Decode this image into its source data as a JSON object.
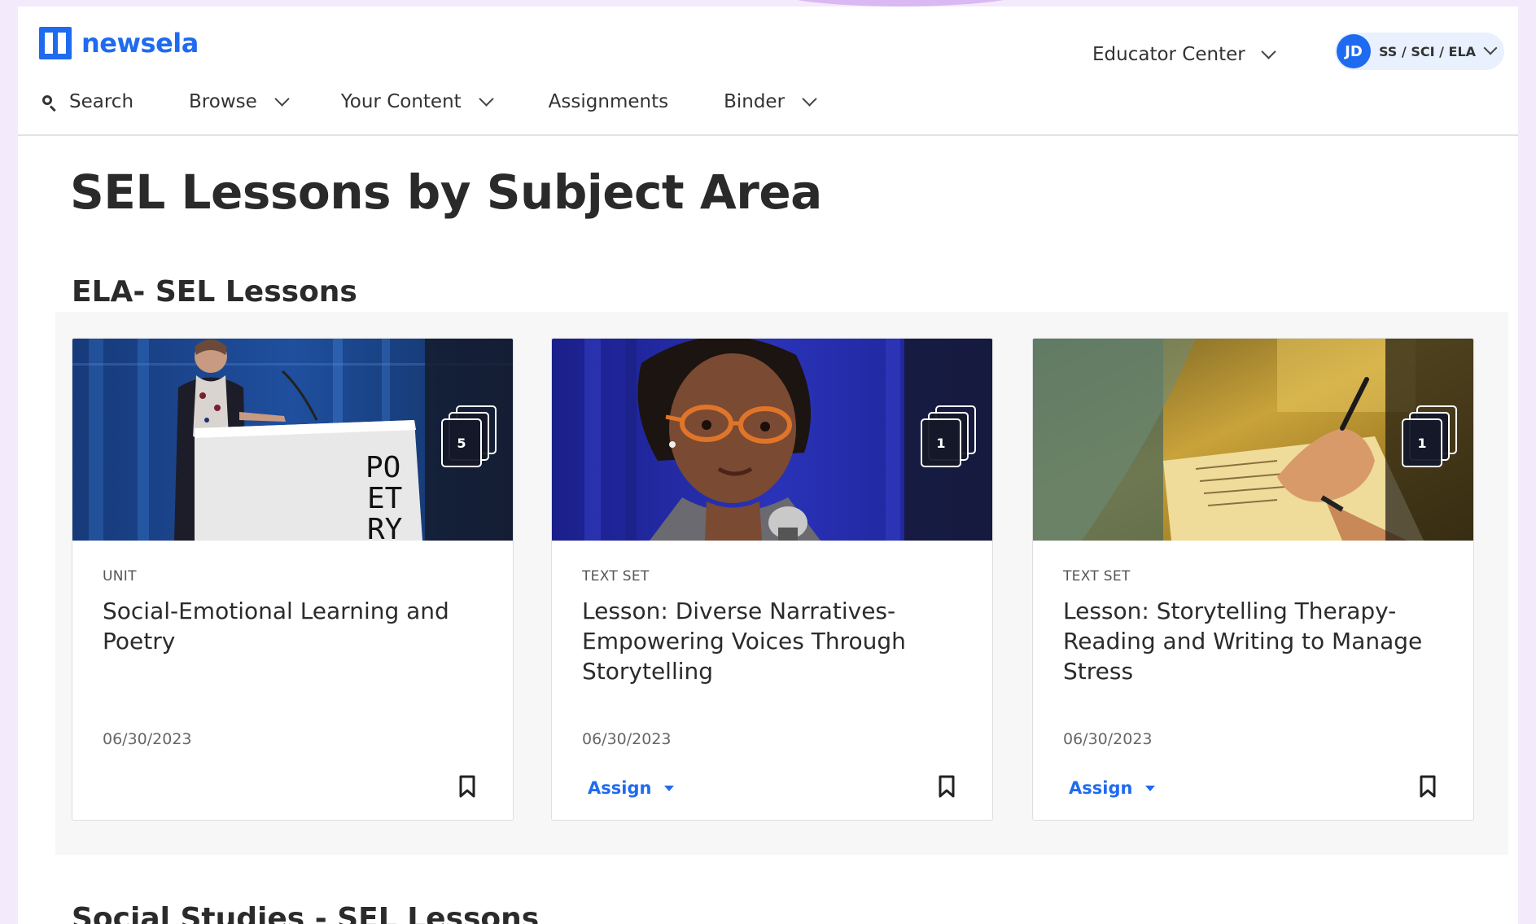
{
  "header": {
    "logo_text": "newsela",
    "educator_center": "Educator Center",
    "user": {
      "initials": "JD",
      "label": "SS / SCI / ELA"
    },
    "nav": {
      "search": "Search",
      "browse": "Browse",
      "your_content": "Your Content",
      "assignments": "Assignments",
      "binder": "Binder"
    }
  },
  "page": {
    "title": "SEL Lessons by Subject Area"
  },
  "sections": [
    {
      "title": "ELA- SEL Lessons",
      "cards": [
        {
          "type": "UNIT",
          "title": "Social-Emotional Learning and Poetry",
          "date": "06/30/2023",
          "count": "5",
          "assign_label": "",
          "image_text": "PO ET RY"
        },
        {
          "type": "TEXT SET",
          "title": "Lesson: Diverse Narratives-Empowering Voices Through Storytelling",
          "date": "06/30/2023",
          "count": "1",
          "assign_label": "Assign"
        },
        {
          "type": "TEXT SET",
          "title": "Lesson: Storytelling Therapy- Reading and Writing to Manage Stress",
          "date": "06/30/2023",
          "count": "1",
          "assign_label": "Assign"
        }
      ]
    },
    {
      "title": "Social Studies - SEL Lessons"
    }
  ],
  "colors": {
    "brand_blue": "#1f6bf0",
    "page_bg": "#f3eafc",
    "band_bg": "#f7f7f7"
  },
  "icons": [
    "logo-icon",
    "search-icon",
    "chevron-down-icon",
    "stack-icon",
    "bookmark-icon",
    "caret-down-icon"
  ]
}
